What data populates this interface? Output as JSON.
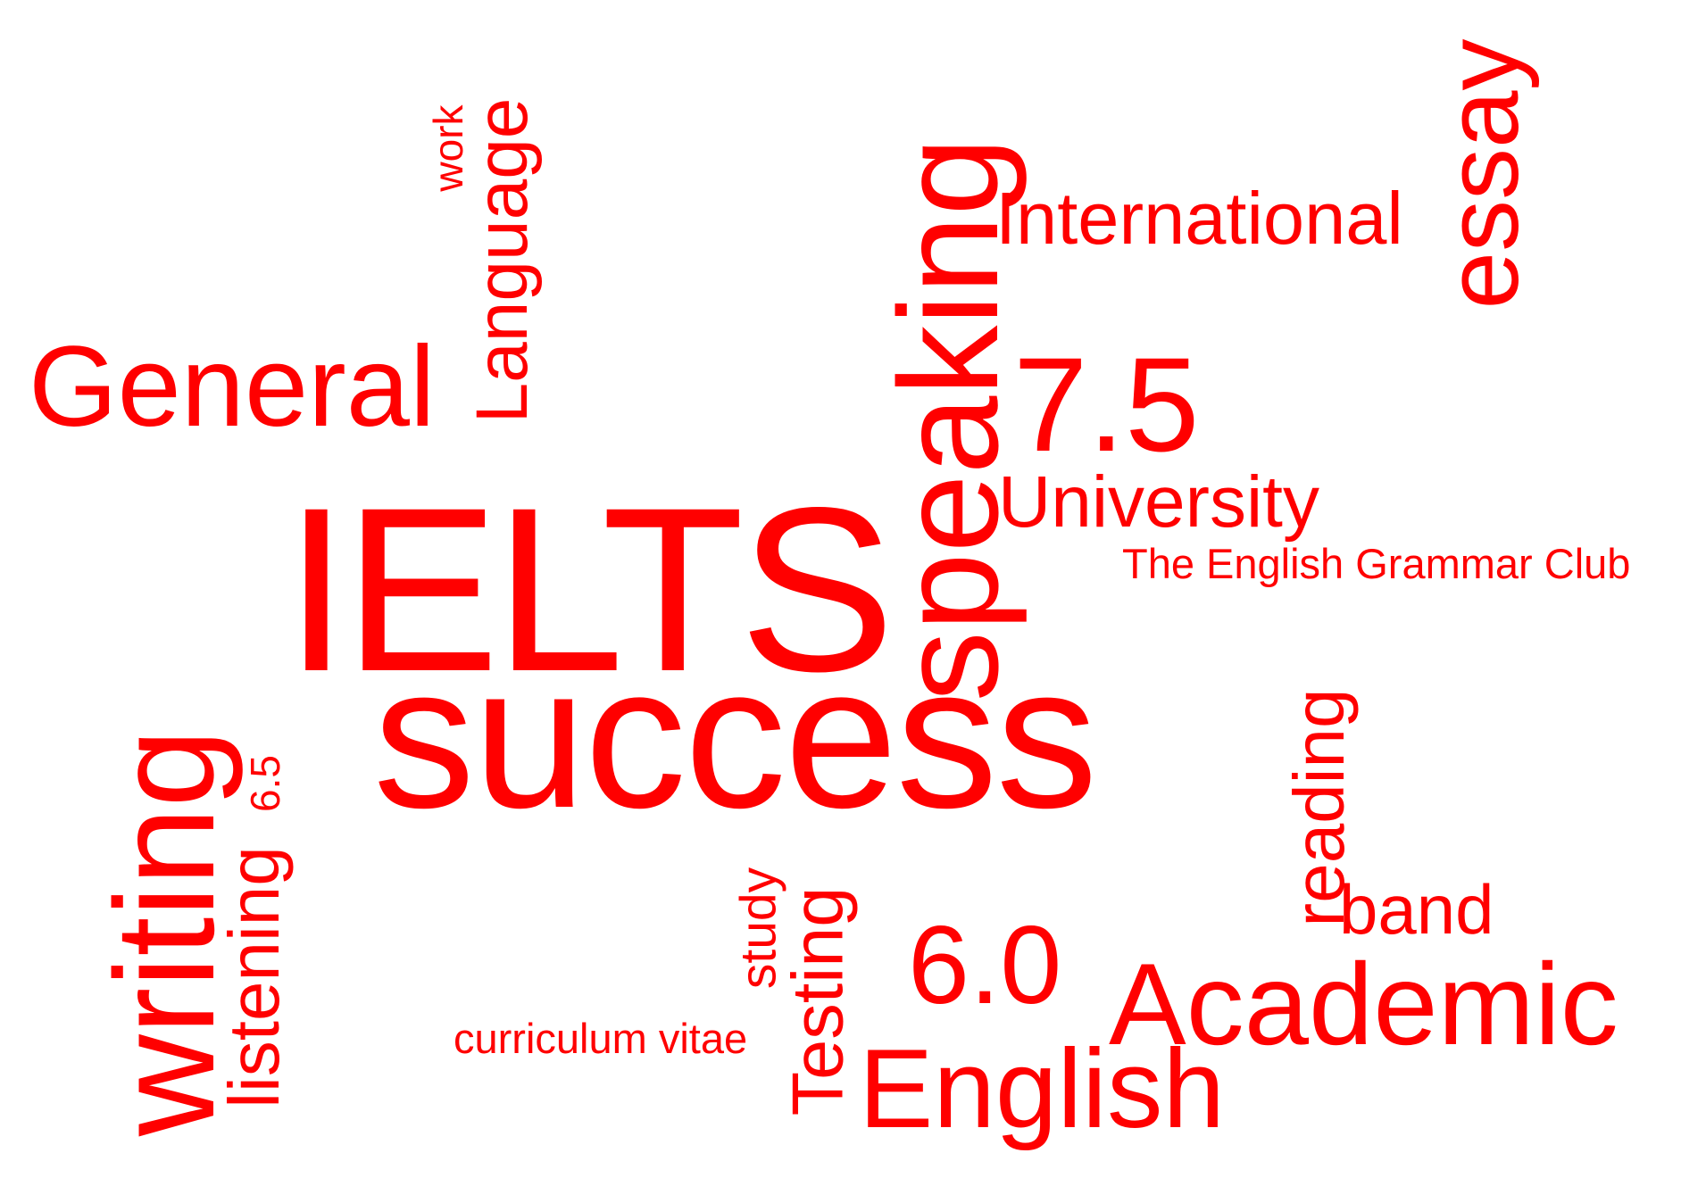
{
  "accent_color": "#ff0000",
  "background_color": "#ffffff",
  "words": {
    "ielts": "IELTS",
    "success": "success",
    "speaking": "speaking",
    "writing": "writing",
    "general": "General",
    "language": "Language",
    "work": "work",
    "international": "International",
    "essay": "essay",
    "seven_five": "7.5",
    "university": "University",
    "club": "The English Grammar Club",
    "reading": "reading",
    "band": "band",
    "academic": "Academic",
    "english": "English",
    "six_zero": "6.0",
    "testing": "Testing",
    "study": "study",
    "cv": "curriculum vitae",
    "listening": "listening",
    "six_five": "6.5"
  }
}
